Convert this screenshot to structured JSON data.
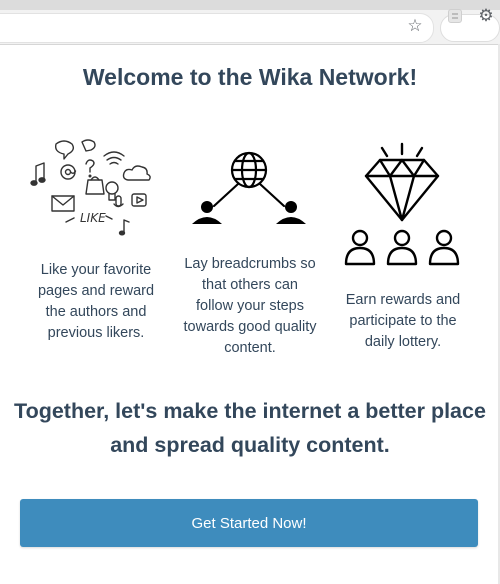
{
  "browser": {
    "toolbar_icons": [
      "star-icon",
      "extension-icon",
      "settings-gear-icon"
    ]
  },
  "popup": {
    "title": "Welcome to the Wika Network!",
    "features": [
      {
        "icon": "social-doodles-icon",
        "text": "Like your favorite pages and reward the authors and previous likers.",
        "doodle_word": "LIKE"
      },
      {
        "icon": "network-globe-icon",
        "text": "Lay breadcrumbs so that others can follow your steps towards good quality content."
      },
      {
        "icon": "diamond-people-icon",
        "text": "Earn rewards and participate to the daily lottery."
      }
    ],
    "tagline": "Together, let's make the internet a better place and spread quality content.",
    "cta_label": "Get Started Now!"
  },
  "colors": {
    "text": "#33475b",
    "button": "#3e8cbd",
    "button_text": "#ffffff"
  }
}
